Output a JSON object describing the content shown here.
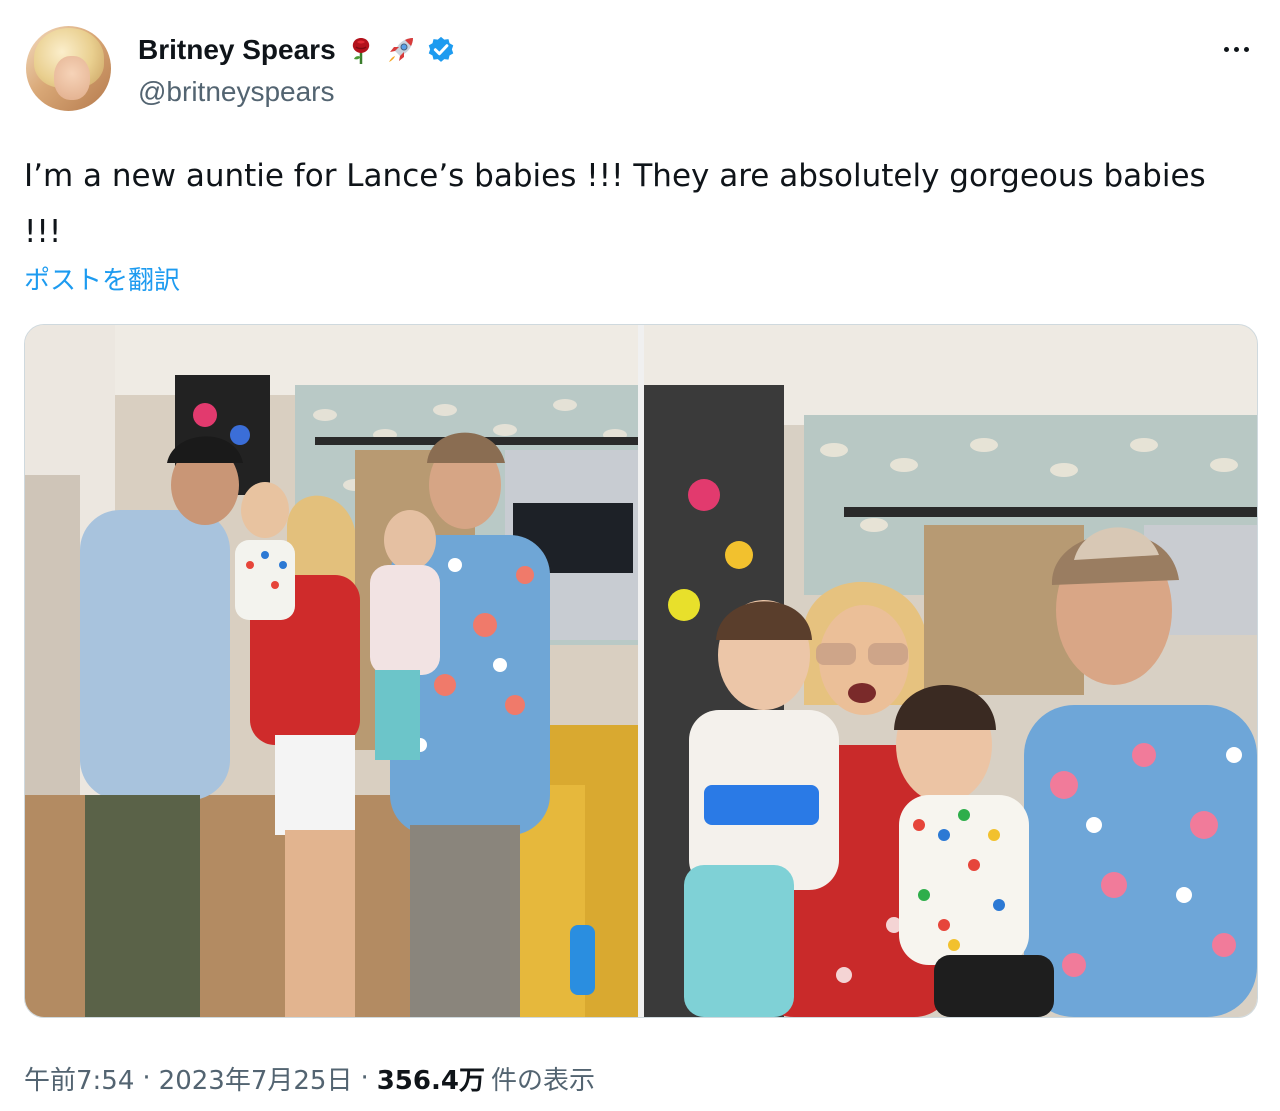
{
  "author": {
    "display_name": "Britney Spears",
    "handle": "@britneyspears",
    "name_emojis": [
      "rose-icon",
      "rocket-icon"
    ],
    "verified": true
  },
  "tweet": {
    "text": "I’m a new auntie for Lance’s babies !!! They are absolutely gorgeous babies\n!!!",
    "translate_label": "ポストを翻訳"
  },
  "meta": {
    "time": "午前7:54",
    "date": "2023年7月25日",
    "views_count": "356.4万",
    "views_label": "件の表示",
    "separator": "·"
  },
  "colors": {
    "link": "#1d9bf0",
    "verified": "#1d9bf0",
    "text": "#0f1419",
    "secondary": "#536471"
  }
}
